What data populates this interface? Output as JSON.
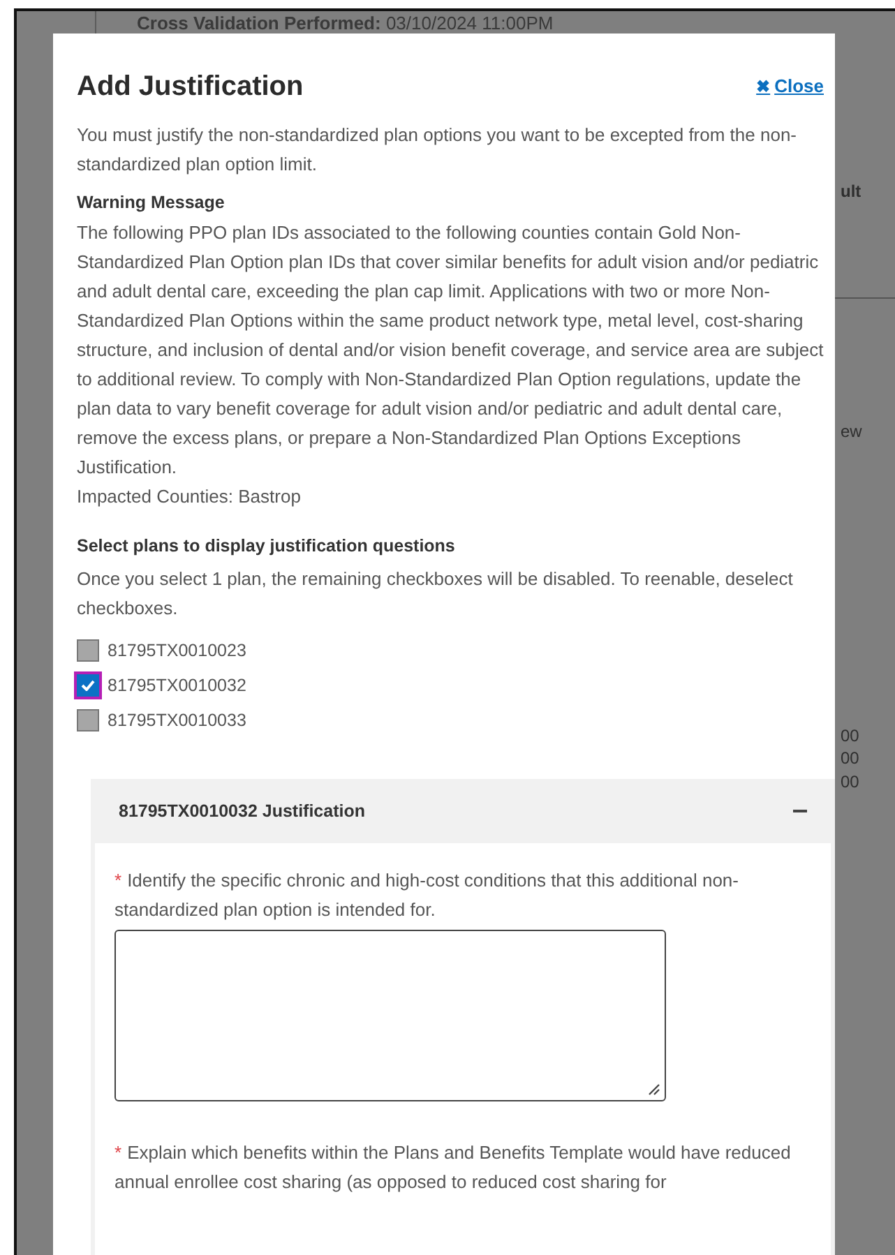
{
  "background_page": {
    "header_label": "Cross Validation Performed:",
    "header_value": "03/10/2024 11:00PM",
    "edge_texts": [
      "ult",
      "ew",
      "00",
      "00",
      "00"
    ]
  },
  "modal": {
    "title": "Add Justification",
    "close": {
      "icon": "✖",
      "label": "Close"
    },
    "intro": "You must justify the non-standardized plan options you want to be excepted from the non-standardized plan option limit.",
    "warning": {
      "heading": "Warning Message",
      "body": "The following PPO plan IDs associated to the following counties contain Gold Non-Standardized Plan Option plan IDs that cover similar benefits for adult vision and/or pediatric and adult dental care, exceeding the plan cap limit. Applications with two or more Non-Standardized Plan Options within the same product network type, metal level, cost-sharing structure, and inclusion of dental and/or vision benefit coverage, and service area are subject to additional review. To comply with Non-Standardized Plan Option regulations, update the plan data to vary benefit coverage for adult vision and/or pediatric and adult dental care, remove the excess plans, or prepare a Non-Standardized Plan Options Exceptions Justification.",
      "counties": "Impacted Counties: Bastrop"
    },
    "plan_select": {
      "heading": "Select plans to display justification questions",
      "hint": "Once you select 1 plan, the remaining checkboxes will be disabled. To reenable, deselect checkboxes.",
      "plans": [
        {
          "label": "81795TX0010023",
          "checked": false,
          "disabled": true,
          "focused": false
        },
        {
          "label": "81795TX0010032",
          "checked": true,
          "disabled": false,
          "focused": true
        },
        {
          "label": "81795TX0010033",
          "checked": false,
          "disabled": true,
          "focused": false
        }
      ]
    },
    "justification": {
      "title": "81795TX0010032 Justification",
      "expanded": true,
      "questions": [
        {
          "required_mark": "*",
          "text": "Identify the specific chronic and high-cost conditions that this additional non-standardized plan option is intended for.",
          "kind": "textarea"
        },
        {
          "required_mark": "*",
          "text": "Explain which benefits within the Plans and Benefits Template would have reduced annual enrollee cost sharing (as opposed to reduced cost sharing for",
          "kind": "text"
        }
      ]
    }
  }
}
